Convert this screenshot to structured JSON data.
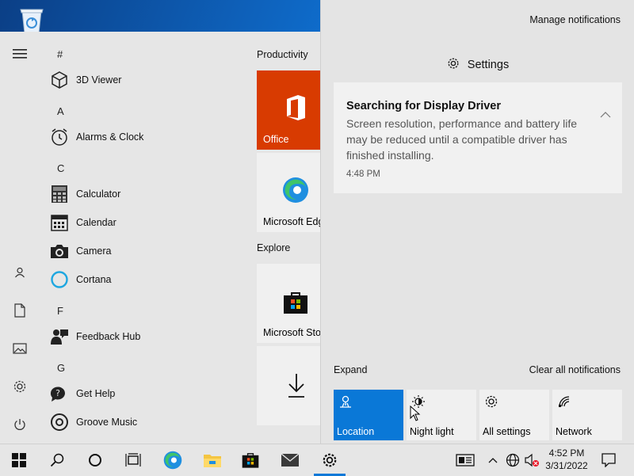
{
  "desktop": {
    "icons": [
      {
        "name": "recycle-bin-icon"
      }
    ]
  },
  "start_menu": {
    "rail": [
      {
        "icon": "hamburger-menu-icon"
      },
      {
        "icon": "user-icon"
      },
      {
        "icon": "documents-icon"
      },
      {
        "icon": "pictures-icon"
      },
      {
        "icon": "settings-gear-icon"
      },
      {
        "icon": "power-icon"
      }
    ],
    "groups": [
      {
        "letter": "#",
        "apps": [
          {
            "label": "3D Viewer",
            "icon": "3d-viewer-icon"
          }
        ]
      },
      {
        "letter": "A",
        "apps": [
          {
            "label": "Alarms & Clock",
            "icon": "alarm-clock-icon"
          }
        ]
      },
      {
        "letter": "C",
        "apps": [
          {
            "label": "Calculator",
            "icon": "calculator-icon"
          },
          {
            "label": "Calendar",
            "icon": "calendar-icon"
          },
          {
            "label": "Camera",
            "icon": "camera-icon"
          },
          {
            "label": "Cortana",
            "icon": "cortana-icon"
          }
        ]
      },
      {
        "letter": "F",
        "apps": [
          {
            "label": "Feedback Hub",
            "icon": "feedback-hub-icon"
          }
        ]
      },
      {
        "letter": "G",
        "apps": [
          {
            "label": "Get Help",
            "icon": "get-help-icon"
          },
          {
            "label": "Groove Music",
            "icon": "groove-music-icon"
          }
        ]
      }
    ],
    "tiles": {
      "productivity_header": "Productivity",
      "explore_header": "Explore",
      "office": "Office",
      "edge": "Microsoft Edge",
      "store": "Microsoft Store",
      "download_icon": "download-arrow-icon"
    }
  },
  "action_center": {
    "manage_notifications": "Manage notifications",
    "group_title": "Settings",
    "notification": {
      "title": "Searching for Display Driver",
      "body": "Screen resolution, performance and battery life may be reduced until a compatible driver has finished installing.",
      "time": "4:48 PM"
    },
    "expand": "Expand",
    "clear_all": "Clear all notifications",
    "quick_actions": [
      {
        "label": "Location",
        "icon": "location-icon",
        "active": true
      },
      {
        "label": "Night light",
        "icon": "night-light-icon",
        "active": false
      },
      {
        "label": "All settings",
        "icon": "settings-gear-icon",
        "active": false
      },
      {
        "label": "Network",
        "icon": "network-icon",
        "active": false
      }
    ]
  },
  "taskbar": {
    "clock": {
      "time": "4:52 PM",
      "date": "3/31/2022"
    }
  },
  "colors": {
    "accent": "#0a78d7",
    "office_tile": "#d83b01"
  }
}
